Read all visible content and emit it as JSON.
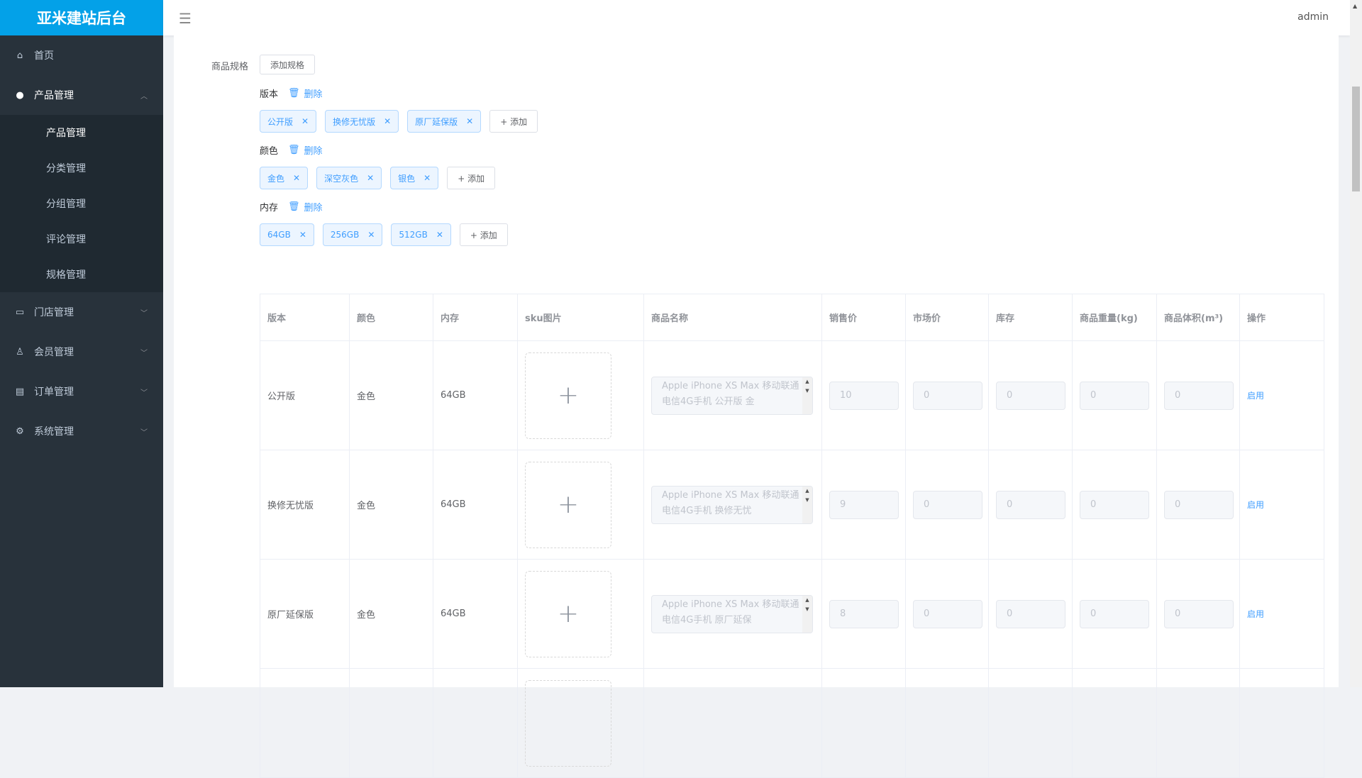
{
  "app": {
    "title": "亚米建站后台",
    "user": "admin"
  },
  "sidebar": {
    "home": "首页",
    "product": {
      "label": "产品管理",
      "items": [
        "产品管理",
        "分类管理",
        "分组管理",
        "评论管理",
        "规格管理"
      ]
    },
    "groups": [
      {
        "label": "门店管理",
        "icon": "store-icon"
      },
      {
        "label": "会员管理",
        "icon": "award-icon"
      },
      {
        "label": "订单管理",
        "icon": "document-icon"
      },
      {
        "label": "系统管理",
        "icon": "gear-icon"
      }
    ]
  },
  "spec": {
    "label": "商品规格",
    "add_spec": "添加规格",
    "delete": "删除",
    "add": "+ 添加",
    "groups": [
      {
        "name": "版本",
        "values": [
          "公开版",
          "换修无忧版",
          "原厂延保版"
        ]
      },
      {
        "name": "颜色",
        "values": [
          "金色",
          "深空灰色",
          "银色"
        ]
      },
      {
        "name": "内存",
        "values": [
          "64GB",
          "256GB",
          "512GB"
        ]
      }
    ]
  },
  "table": {
    "headers": [
      "版本",
      "颜色",
      "内存",
      "sku图片",
      "商品名称",
      "销售价",
      "市场价",
      "库存",
      "商品重量(kg)",
      "商品体积(m³)",
      "操作"
    ],
    "rows": [
      {
        "version": "公开版",
        "color": "金色",
        "memory": "64GB",
        "name": "Apple iPhone XS Max 移动联通电信4G手机  公开版 金",
        "price": "10",
        "market": "0",
        "stock": "0",
        "weight": "0",
        "volume": "0",
        "action": "启用"
      },
      {
        "version": "换修无忧版",
        "color": "金色",
        "memory": "64GB",
        "name": "Apple iPhone XS Max 移动联通电信4G手机  换修无忧",
        "price": "9",
        "market": "0",
        "stock": "0",
        "weight": "0",
        "volume": "0",
        "action": "启用"
      },
      {
        "version": "原厂延保版",
        "color": "金色",
        "memory": "64GB",
        "name": "Apple iPhone XS Max 移动联通电信4G手机  原厂延保",
        "price": "8",
        "market": "0",
        "stock": "0",
        "weight": "0",
        "volume": "0",
        "action": "启用"
      }
    ]
  },
  "colors": {
    "brand": "#03a1e8",
    "sidebar": "#28323b",
    "primary": "#409eff"
  }
}
